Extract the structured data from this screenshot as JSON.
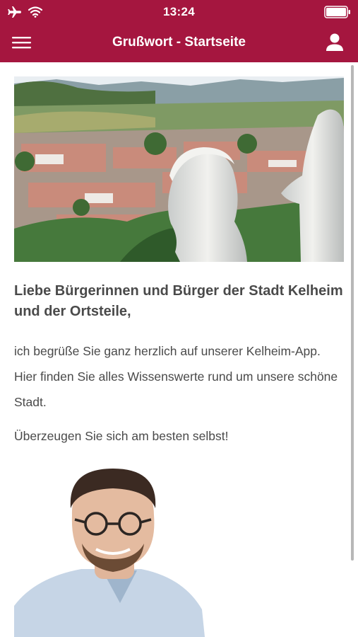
{
  "status": {
    "time": "13:24"
  },
  "header": {
    "title": "Grußwort - Startseite"
  },
  "icons": {
    "airplane": "airplane-icon",
    "wifi": "wifi-icon",
    "battery": "battery-icon",
    "menu": "hamburger-menu-icon",
    "profile": "user-profile-icon"
  },
  "colors": {
    "brand": "#a5163f",
    "text": "#4a4a4a"
  },
  "content": {
    "heading": "Liebe Bürgerinnen und Bürger der Stadt Kelheim und der Ortsteile,",
    "paragraph1": "ich begrüße Sie ganz herzlich auf unserer Kelheim-App. Hier finden Sie alles Wissenswerte rund um unsere schöne Stadt.",
    "paragraph2": "Überzeugen Sie sich am besten selbst!"
  }
}
